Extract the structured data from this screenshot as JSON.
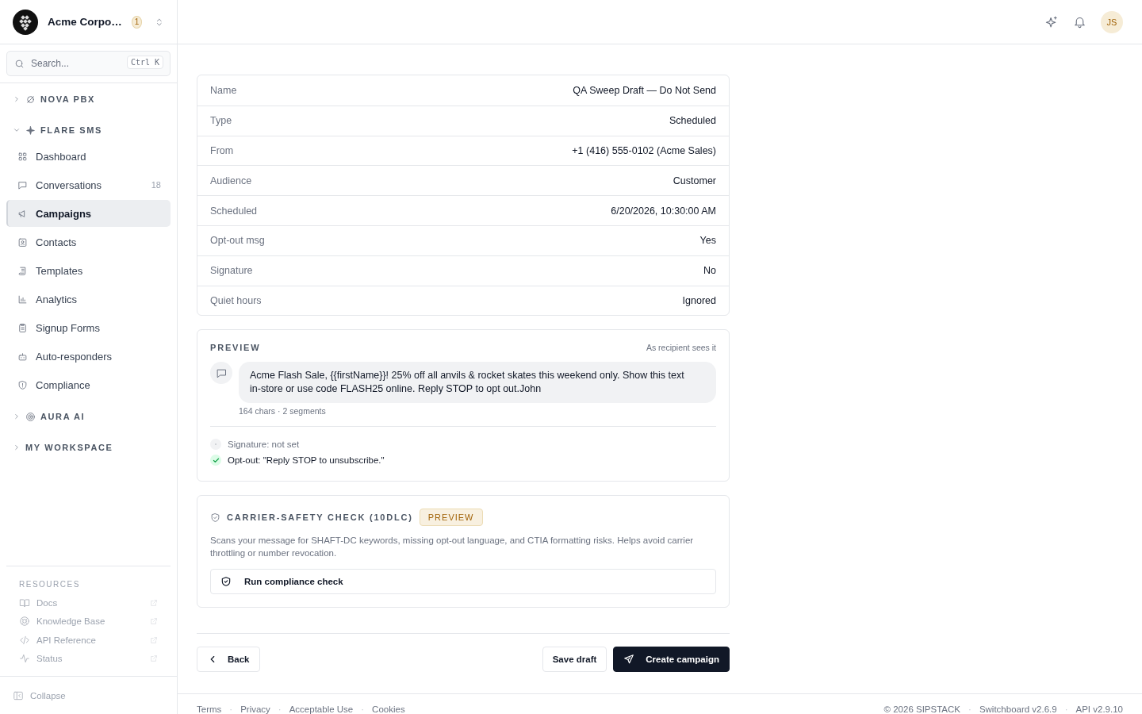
{
  "workspace": {
    "name": "Acme Corpo…",
    "badge": "1"
  },
  "search": {
    "placeholder": "Search...",
    "shortcut": "Ctrl K"
  },
  "nav_groups": [
    {
      "label": "NOVA PBX",
      "expanded": false
    },
    {
      "label": "FLARE SMS",
      "expanded": true,
      "items": [
        {
          "label": "Dashboard",
          "selected": false
        },
        {
          "label": "Conversations",
          "count": "18",
          "selected": false
        },
        {
          "label": "Campaigns",
          "selected": true
        },
        {
          "label": "Contacts",
          "selected": false
        },
        {
          "label": "Templates",
          "selected": false
        },
        {
          "label": "Analytics",
          "selected": false
        },
        {
          "label": "Signup Forms",
          "selected": false
        },
        {
          "label": "Auto-responders",
          "selected": false
        },
        {
          "label": "Compliance",
          "selected": false
        }
      ]
    },
    {
      "label": "AURA AI",
      "expanded": false
    },
    {
      "label": "MY WORKSPACE",
      "expanded": false
    }
  ],
  "resources": {
    "title": "RESOURCES",
    "links": [
      "Docs",
      "Knowledge Base",
      "API Reference",
      "Status"
    ]
  },
  "collapse": "Collapse",
  "header": {
    "avatar": "JS"
  },
  "summary": [
    {
      "label": "Name",
      "value": "QA Sweep Draft — Do Not Send"
    },
    {
      "label": "Type",
      "value": "Scheduled"
    },
    {
      "label": "From",
      "value": "+1 (416) 555-0102 (Acme Sales)"
    },
    {
      "label": "Audience",
      "value": "Customer"
    },
    {
      "label": "Scheduled",
      "value": "6/20/2026, 10:30:00 AM"
    },
    {
      "label": "Opt-out msg",
      "value": "Yes"
    },
    {
      "label": "Signature",
      "value": "No"
    },
    {
      "label": "Quiet hours",
      "value": "Ignored"
    }
  ],
  "preview": {
    "title": "PREVIEW",
    "note": "As recipient sees it",
    "message": "Acme Flash Sale, {{firstName}}! 25% off all anvils & rocket skates this weekend only. Show this text in-store or use code FLASH25 online. Reply STOP to opt out.John",
    "stats": "164 chars · 2 segments",
    "checks": [
      {
        "text": "Signature: not set",
        "ok": false
      },
      {
        "text": "Opt-out: \"Reply STOP to unsubscribe.\"",
        "ok": true
      }
    ]
  },
  "carrier_check": {
    "title": "CARRIER-SAFETY CHECK (10DLC)",
    "badge": "PREVIEW",
    "description": "Scans your message for SHAFT-DC keywords, missing opt-out language, and CTIA formatting risks. Helps avoid carrier throttling or number revocation.",
    "button": "Run compliance check"
  },
  "actions": {
    "back": "Back",
    "save": "Save draft",
    "create": "Create campaign"
  },
  "footer": {
    "separator": "·",
    "links": [
      "Terms",
      "Privacy",
      "Acceptable Use",
      "Cookies"
    ],
    "meta": [
      "© 2026 SIPSTACK",
      "Switchboard v2.6.9",
      "API v2.9.10"
    ]
  }
}
